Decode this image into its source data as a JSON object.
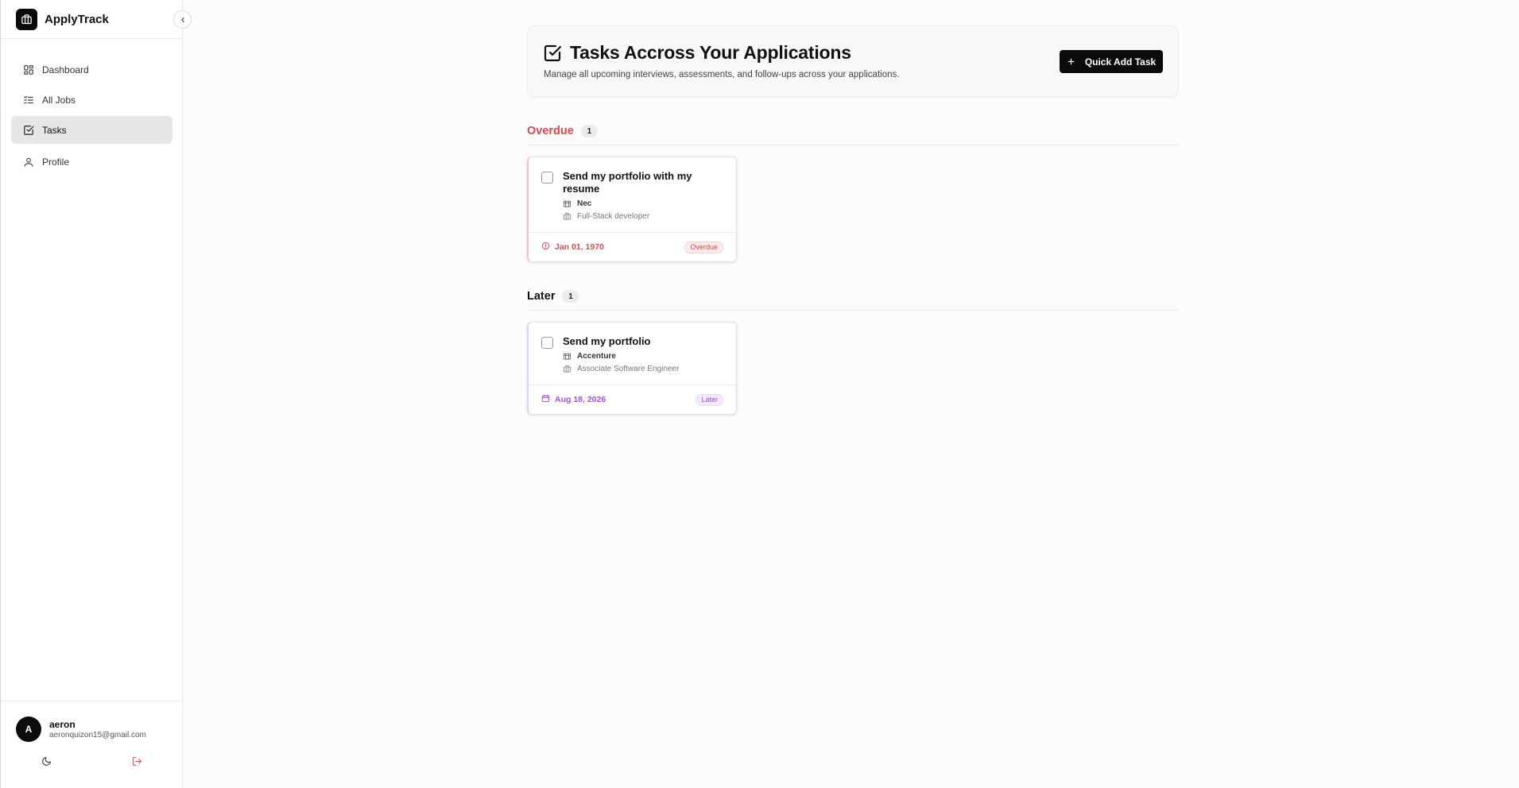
{
  "app": {
    "name": "ApplyTrack"
  },
  "sidebar": {
    "items": [
      {
        "label": "Dashboard",
        "icon": "dashboard-icon"
      },
      {
        "label": "All Jobs",
        "icon": "list-icon"
      },
      {
        "label": "Tasks",
        "icon": "checkbox-icon",
        "active": true
      },
      {
        "label": "Profile",
        "icon": "user-icon"
      }
    ]
  },
  "user": {
    "initial": "A",
    "name": "aeron",
    "email": "aeronquizon15@gmail.com"
  },
  "header": {
    "title": "Tasks Accross Your Applications",
    "description": "Manage all upcoming interviews, assessments, and follow-ups across your applications.",
    "quick_add_label": "Quick Add Task"
  },
  "sections": [
    {
      "title": "Overdue",
      "count": "1",
      "tasks": [
        {
          "title": "Send my portfolio with my resume",
          "company": "Nec",
          "role": "Full-Stack developer",
          "due": "Jan 01, 1970",
          "status": "Overdue"
        }
      ]
    },
    {
      "title": "Later",
      "count": "1",
      "tasks": [
        {
          "title": "Send my portfolio",
          "company": "Accenture",
          "role": "Associate Software Engineer",
          "due": "Aug 18, 2026",
          "status": "Later"
        }
      ]
    }
  ],
  "colors": {
    "overdue": "#e0454d",
    "later": "#a24ee6",
    "primary": "#0b0b0b"
  }
}
